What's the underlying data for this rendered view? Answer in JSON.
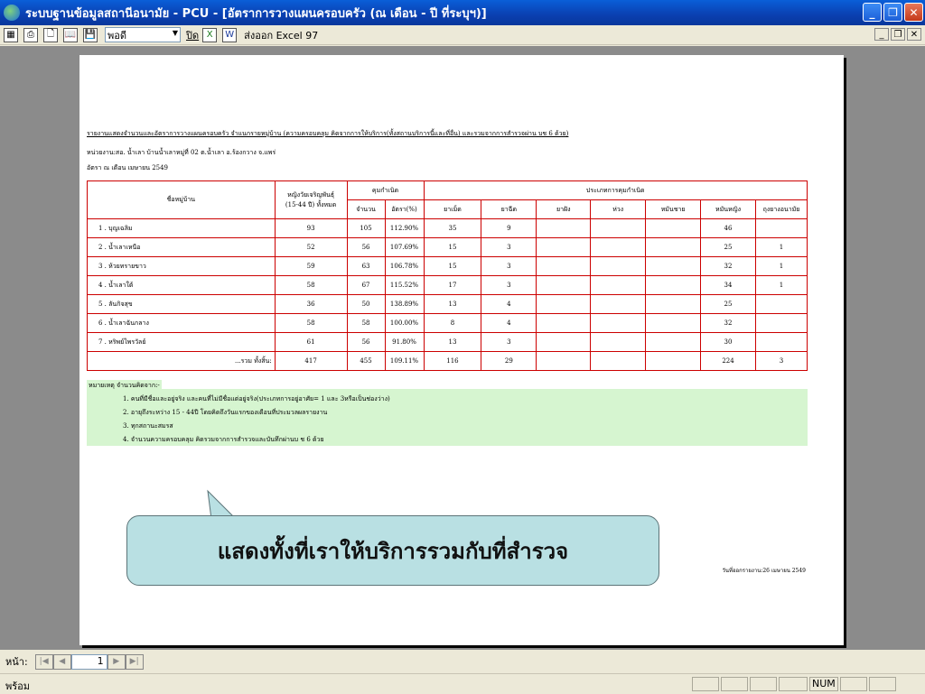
{
  "window": {
    "title": "ระบบฐานข้อมูลสถานีอนามัย - PCU - [อัตราการวางแผนครอบครัว (ณ เดือน - ปี ที่ระบุฯ)]"
  },
  "toolbar": {
    "zoom_value": "พอดี",
    "close_label": "ปิด",
    "export_label": "ส่งออก Excel 97"
  },
  "report": {
    "title": "รายงานแสดงจำนวนและอัตราการวางแผนครอบครัว จำแนกรายหมู่บ้าน (ความครอบคลุม คิดจากการให้บริการ(ทั้งสถานบริการนี้และที่อื่น) และรวมจากการสำรวจผ่าน บช 6 ด้วย)",
    "unit": "หน่วยงาน:สอ. น้ำเลา บ้านน้ำเลาหมู่ที่ 02  ต.น้ำเลา อ.ร้องกวาง จ.แพร่",
    "as_of": "อัตรา ณ เดือน เมษายน  2549",
    "headers": {
      "village": "ชื่อหมู่บ้าน",
      "women": "หญิงวัยเจริญพันธุ์",
      "women_sub": "(15-44 ปี) ทั้งหมด",
      "coverage": "คุมกำเนิด",
      "count": "จำนวน",
      "rate": "อัตรา(%)",
      "method": "ประเภทการคุมกำเนิด",
      "methods": [
        "ยาเม็ด",
        "ยาฉีด",
        "ยาฝัง",
        "ห่วง",
        "หมันชาย",
        "หมันหญิง",
        "ถุงยางอนามัย"
      ]
    },
    "rows": [
      {
        "name": "1 . บุญเฉลิม",
        "women": "93",
        "count": "105",
        "rate": "112.90%",
        "m": [
          "35",
          "9",
          "",
          "",
          "",
          "46",
          ""
        ]
      },
      {
        "name": "2 . น้ำเลาเหนือ",
        "women": "52",
        "count": "56",
        "rate": "107.69%",
        "m": [
          "15",
          "3",
          "",
          "",
          "",
          "25",
          "1"
        ]
      },
      {
        "name": "3 . ห้วยทรายขาว",
        "women": "59",
        "count": "63",
        "rate": "106.78%",
        "m": [
          "15",
          "3",
          "",
          "",
          "",
          "32",
          "1"
        ]
      },
      {
        "name": "4 . น้ำเลาใต้",
        "women": "58",
        "count": "67",
        "rate": "115.52%",
        "m": [
          "17",
          "3",
          "",
          "",
          "",
          "34",
          "1"
        ]
      },
      {
        "name": "5 . ลันกิจสุข",
        "women": "36",
        "count": "50",
        "rate": "138.89%",
        "m": [
          "13",
          "4",
          "",
          "",
          "",
          "25",
          ""
        ]
      },
      {
        "name": "6 . น้ำเลาฉันกลาง",
        "women": "58",
        "count": "58",
        "rate": "100.00%",
        "m": [
          "8",
          "4",
          "",
          "",
          "",
          "32",
          ""
        ]
      },
      {
        "name": "7 . หริพย์ไพรวัลย์",
        "women": "61",
        "count": "56",
        "rate": "91.80%",
        "m": [
          "13",
          "3",
          "",
          "",
          "",
          "30",
          ""
        ]
      }
    ],
    "total": {
      "label": "...รวม ทั้งสิ้น:",
      "women": "417",
      "count": "455",
      "rate": "109.11%",
      "m": [
        "116",
        "29",
        "",
        "",
        "",
        "224",
        "3"
      ]
    },
    "notes_head": "หมายเหตุ  จำนวนคิดจาก:-",
    "notes": [
      "1. คนที่มีชื่อและอยู่จริง และคนที่ไม่มีชื่อแต่อยู่จริง(ประเภทการอยู่อาศัย= 1 และ 3หรือเป็นช่องว่าง)",
      "2. อายุถึงระหว่าง 15 - 44ปี โดยคิดถึงวันแรกของเดือนที่ประมวลผลรายงาน",
      "3. ทุกสถานะสมรส",
      "4. จำนวนความครอบคลุม คิดรวมจากการสำรวจและบันทึกผ่านบ ช 6 ด้วย"
    ],
    "signature": "วันที่ออกรายงาน:26 เมษายน 2549"
  },
  "callout": {
    "text": "แสดงทั้งที่เราให้บริการรวมกับที่สำรวจ"
  },
  "nav": {
    "page_label": "หน้า:",
    "page_value": "1"
  },
  "status": {
    "text": "พร้อม",
    "num": "NUM"
  }
}
